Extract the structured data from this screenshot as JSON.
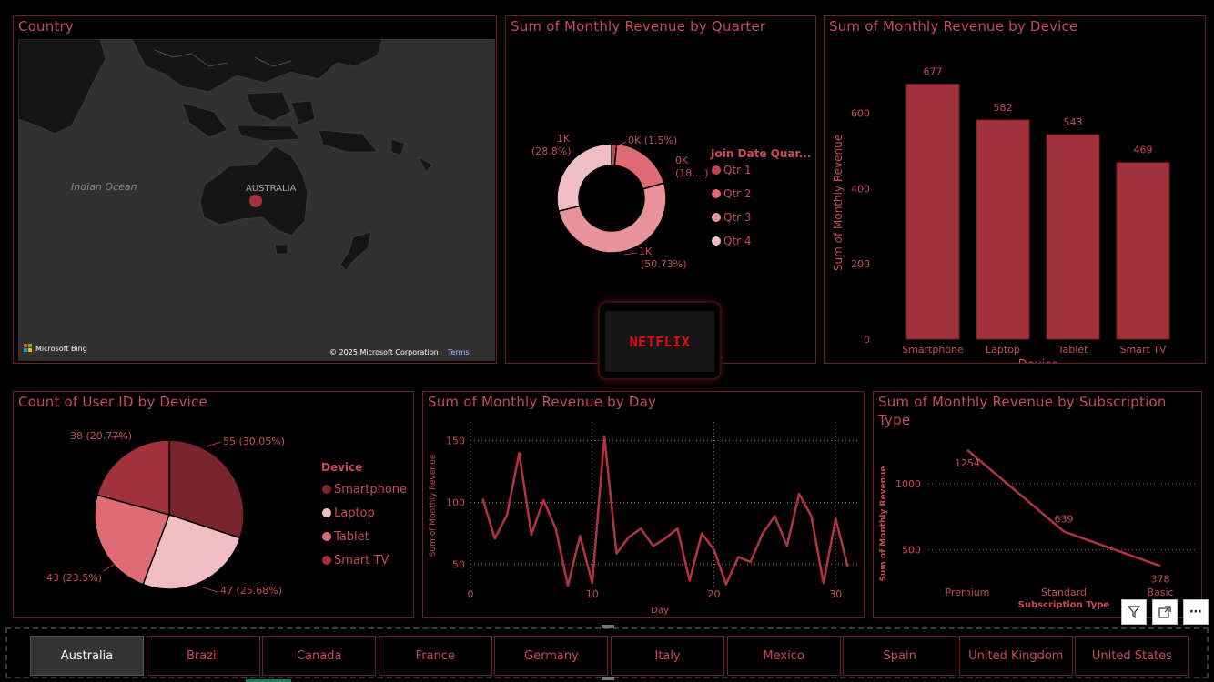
{
  "map": {
    "title": "Country",
    "ocean_label": "Indian Ocean",
    "country_label": "AUSTRALIA",
    "bing_label": "Microsoft Bing",
    "copyright": "© 2025 Microsoft Corporation",
    "terms": "Terms"
  },
  "donut": {
    "title": "Sum of Monthly Revenue by Quarter",
    "legend_title": "Join Date Quar...",
    "labels": {
      "q1_a": "0K (1.5%)",
      "q2_a": "0K",
      "q2_b": "(18....)",
      "q3_a": "1K",
      "q3_b": "(50.73%)",
      "q4_a": "1K",
      "q4_b": "(28.8%)"
    }
  },
  "bar": {
    "title": "Sum of Monthly Revenue by Device"
  },
  "pie": {
    "title": "Count of User ID by Device",
    "legend_title": "Device",
    "labels": {
      "smartphone": "55 (30.05%)",
      "laptop": "47 (25.68%)",
      "tablet": "43 (23.5%)",
      "smarttv": "38 (20.77%)"
    }
  },
  "line_day": {
    "title": "Sum of Monthly Revenue by Day"
  },
  "line_sub": {
    "title_line1": "Sum of Monthly Revenue by Subscription",
    "title_line2": "Type"
  },
  "logo": {
    "text": "NETFLIX"
  },
  "slicer": {
    "countries": [
      "Australia",
      "Brazil",
      "Canada",
      "France",
      "Germany",
      "Italy",
      "Mexico",
      "Spain",
      "United Kingdom",
      "United States"
    ],
    "selected": "Australia"
  },
  "colors": {
    "accent": "#c84a52",
    "bar": "#a1323c",
    "q1": "#c0474f",
    "q2": "#e06b74",
    "q3": "#e8939a",
    "q4": "#f0bec2",
    "smartphone": "#7a252b",
    "laptop": "#f0bec2",
    "tablet": "#e06b74",
    "smarttv": "#a1323c"
  },
  "chart_data": [
    {
      "type": "pie",
      "title": "Sum of Monthly Revenue by Quarter",
      "legend_title": "Join Date Quar...",
      "categories": [
        "Qtr 1",
        "Qtr 2",
        "Qtr 3",
        "Qtr 4"
      ],
      "values": [
        1.5,
        18.97,
        50.73,
        28.8
      ]
    },
    {
      "type": "bar",
      "title": "Sum of Monthly Revenue by Device",
      "xlabel": "Device",
      "ylabel": "Sum of Monthly Revenue",
      "categories": [
        "Smartphone",
        "Laptop",
        "Tablet",
        "Smart TV"
      ],
      "values": [
        677,
        582,
        543,
        469
      ],
      "yticks": [
        0,
        200,
        400,
        600
      ],
      "ylim": [
        0,
        700
      ]
    },
    {
      "type": "pie",
      "title": "Count of User ID by Device",
      "legend_title": "Device",
      "categories": [
        "Smartphone",
        "Laptop",
        "Tablet",
        "Smart TV"
      ],
      "values": [
        55,
        47,
        43,
        38
      ]
    },
    {
      "type": "line",
      "title": "Sum of Monthly Revenue by Day",
      "xlabel": "Day",
      "ylabel": "Sum of Monthly Revenue",
      "x": [
        1,
        2,
        3,
        4,
        5,
        6,
        7,
        8,
        9,
        10,
        11,
        12,
        13,
        14,
        15,
        16,
        17,
        18,
        19,
        20,
        21,
        22,
        23,
        24,
        25,
        26,
        27,
        28,
        29,
        30,
        31
      ],
      "y": [
        103,
        71,
        90,
        140,
        74,
        102,
        79,
        33,
        73,
        35,
        153,
        59,
        72,
        79,
        65,
        71,
        79,
        37,
        75,
        62,
        34,
        56,
        52,
        75,
        89,
        65,
        107,
        89,
        35,
        87,
        48
      ],
      "xticks": [
        0,
        10,
        20,
        30
      ],
      "yticks": [
        50,
        100,
        150
      ],
      "xlim": [
        0,
        32
      ],
      "ylim": [
        30,
        165
      ]
    },
    {
      "type": "line",
      "title": "Sum of Monthly Revenue by Subscription Type",
      "xlabel": "Subscription Type",
      "ylabel": "Sum of Monthly Revenue",
      "categories": [
        "Premium",
        "Standard",
        "Basic"
      ],
      "values": [
        1254,
        639,
        378
      ],
      "yticks": [
        500,
        1000
      ],
      "ylim": [
        250,
        1350
      ]
    }
  ]
}
